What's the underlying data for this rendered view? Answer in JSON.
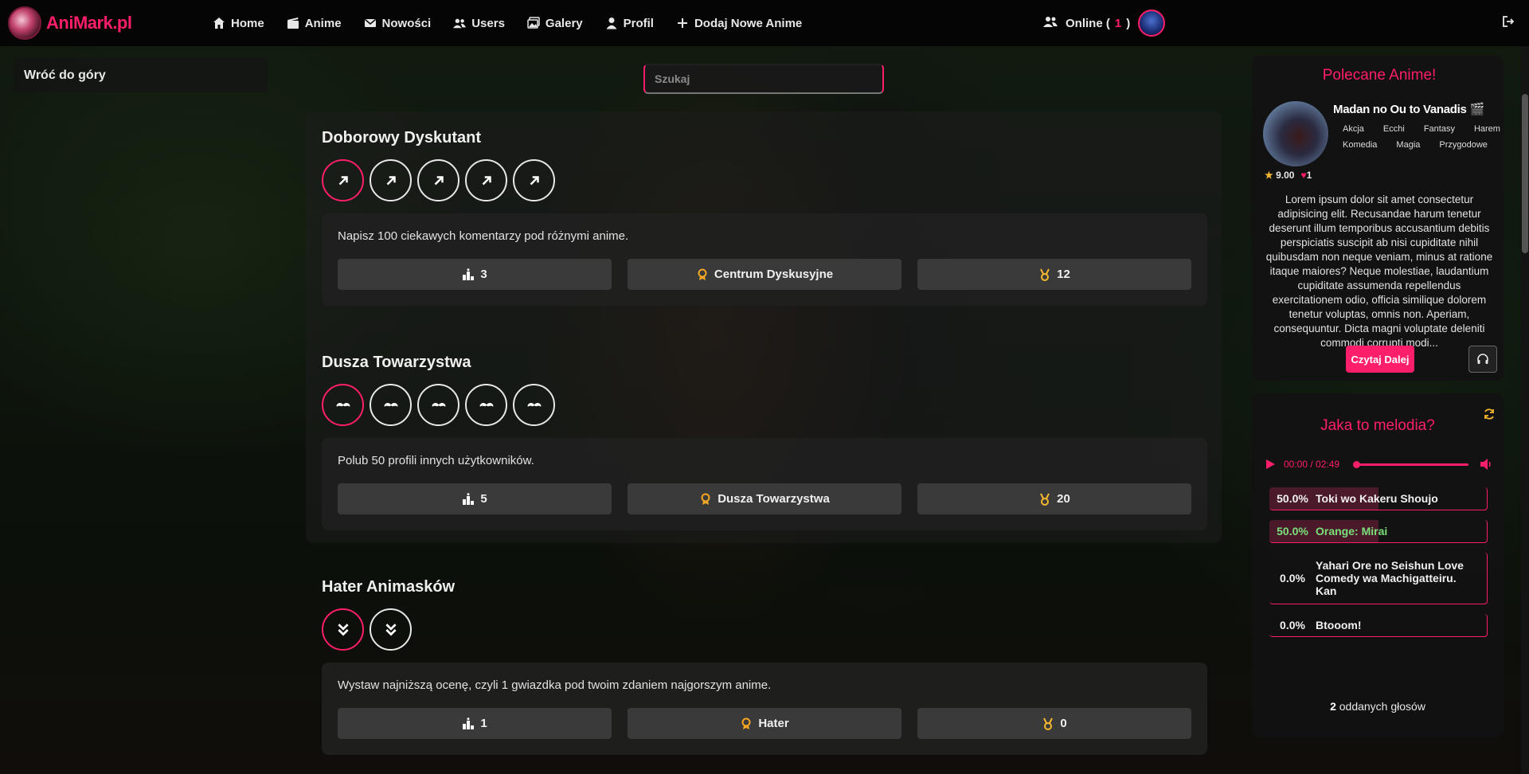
{
  "brand": {
    "name_part1": "Ani",
    "name_part2": "Mark",
    "name_part3": ".pl"
  },
  "nav": {
    "items": [
      {
        "label": "Home",
        "icon": "home-icon"
      },
      {
        "label": "Anime",
        "icon": "film-icon"
      },
      {
        "label": "Nowości",
        "icon": "envelope-icon"
      },
      {
        "label": "Users",
        "icon": "users-icon"
      },
      {
        "label": "Galery",
        "icon": "image-icon"
      },
      {
        "label": "Profil",
        "icon": "user-icon"
      },
      {
        "label": "Dodaj Nowe Anime",
        "icon": "plus-icon"
      }
    ],
    "online_label": "Online (",
    "online_count": "1",
    "online_close": ")"
  },
  "left": {
    "back_to_top": "Wróć do góry"
  },
  "search": {
    "placeholder": "Szukaj"
  },
  "achievements": [
    {
      "title": "Doborowy Dyskutant",
      "level_icon": "arrow-up-right-icon",
      "levels": 5,
      "description": "Napisz 100 ciekawych komentarzy pod różnymi anime.",
      "rank": "3",
      "badge_name": "Centrum Dyskusyjne",
      "points": "12"
    },
    {
      "title": "Dusza Towarzystwa",
      "level_icon": "mustache-icon",
      "levels": 5,
      "description": "Polub 50 profili innych użytkowników.",
      "rank": "5",
      "badge_name": "Dusza Towarzystwa",
      "points": "20"
    },
    {
      "title": "Hater Animasków",
      "level_icon": "double-chevron-down-icon",
      "levels": 2,
      "description": "Wystaw najniższą ocenę, czyli 1 gwiazdka pod twoim zdaniem najgorszym anime.",
      "rank": "1",
      "badge_name": "Hater",
      "points": "0"
    }
  ],
  "recommended": {
    "title": "Polecane Anime!",
    "anime_name": "Madan no Ou to Vanadis",
    "tags": [
      "Akcja",
      "Ecchi",
      "Fantasy",
      "Harem",
      "Komedia",
      "Magia",
      "Przygodowe"
    ],
    "rating": "9.00",
    "likes": "1",
    "summary": "Lorem ipsum dolor sit amet consectetur adipisicing elit. Recusandae harum tenetur deserunt illum temporibus accusantium debitis perspiciatis suscipit ab nisi cupiditate nihil quibusdam non neque veniam, minus at ratione itaque maiores? Neque molestiae, laudantium cupiditate assumenda repellendus exercitationem odio, officia similique dolorem tenetur voluptas, omnis non. Aperiam, consequuntur. Dicta magni voluptate deleniti commodi corrupti modi...",
    "read_more": "Czytaj Dalej"
  },
  "melody": {
    "title": "Jaka to melodia?",
    "time": "00:00 / 02:49",
    "options": [
      {
        "pct": "50.0%",
        "name": "Toki wo Kakeru Shoujo",
        "share": 0.5,
        "correct": false
      },
      {
        "pct": "50.0%",
        "name": "Orange: Mirai",
        "share": 0.5,
        "correct": true
      },
      {
        "pct": "0.0%",
        "name": "Yahari Ore no Seishun Love Comedy wa Machigatteiru. Kan",
        "share": 0,
        "correct": false
      },
      {
        "pct": "0.0%",
        "name": "Btooom!",
        "share": 0,
        "correct": false
      }
    ],
    "votes_count": "2",
    "votes_label": "oddanych głosów"
  },
  "colors": {
    "accent": "#ff1e6a",
    "gold": "#f5b82e",
    "correct": "#7be07b"
  }
}
